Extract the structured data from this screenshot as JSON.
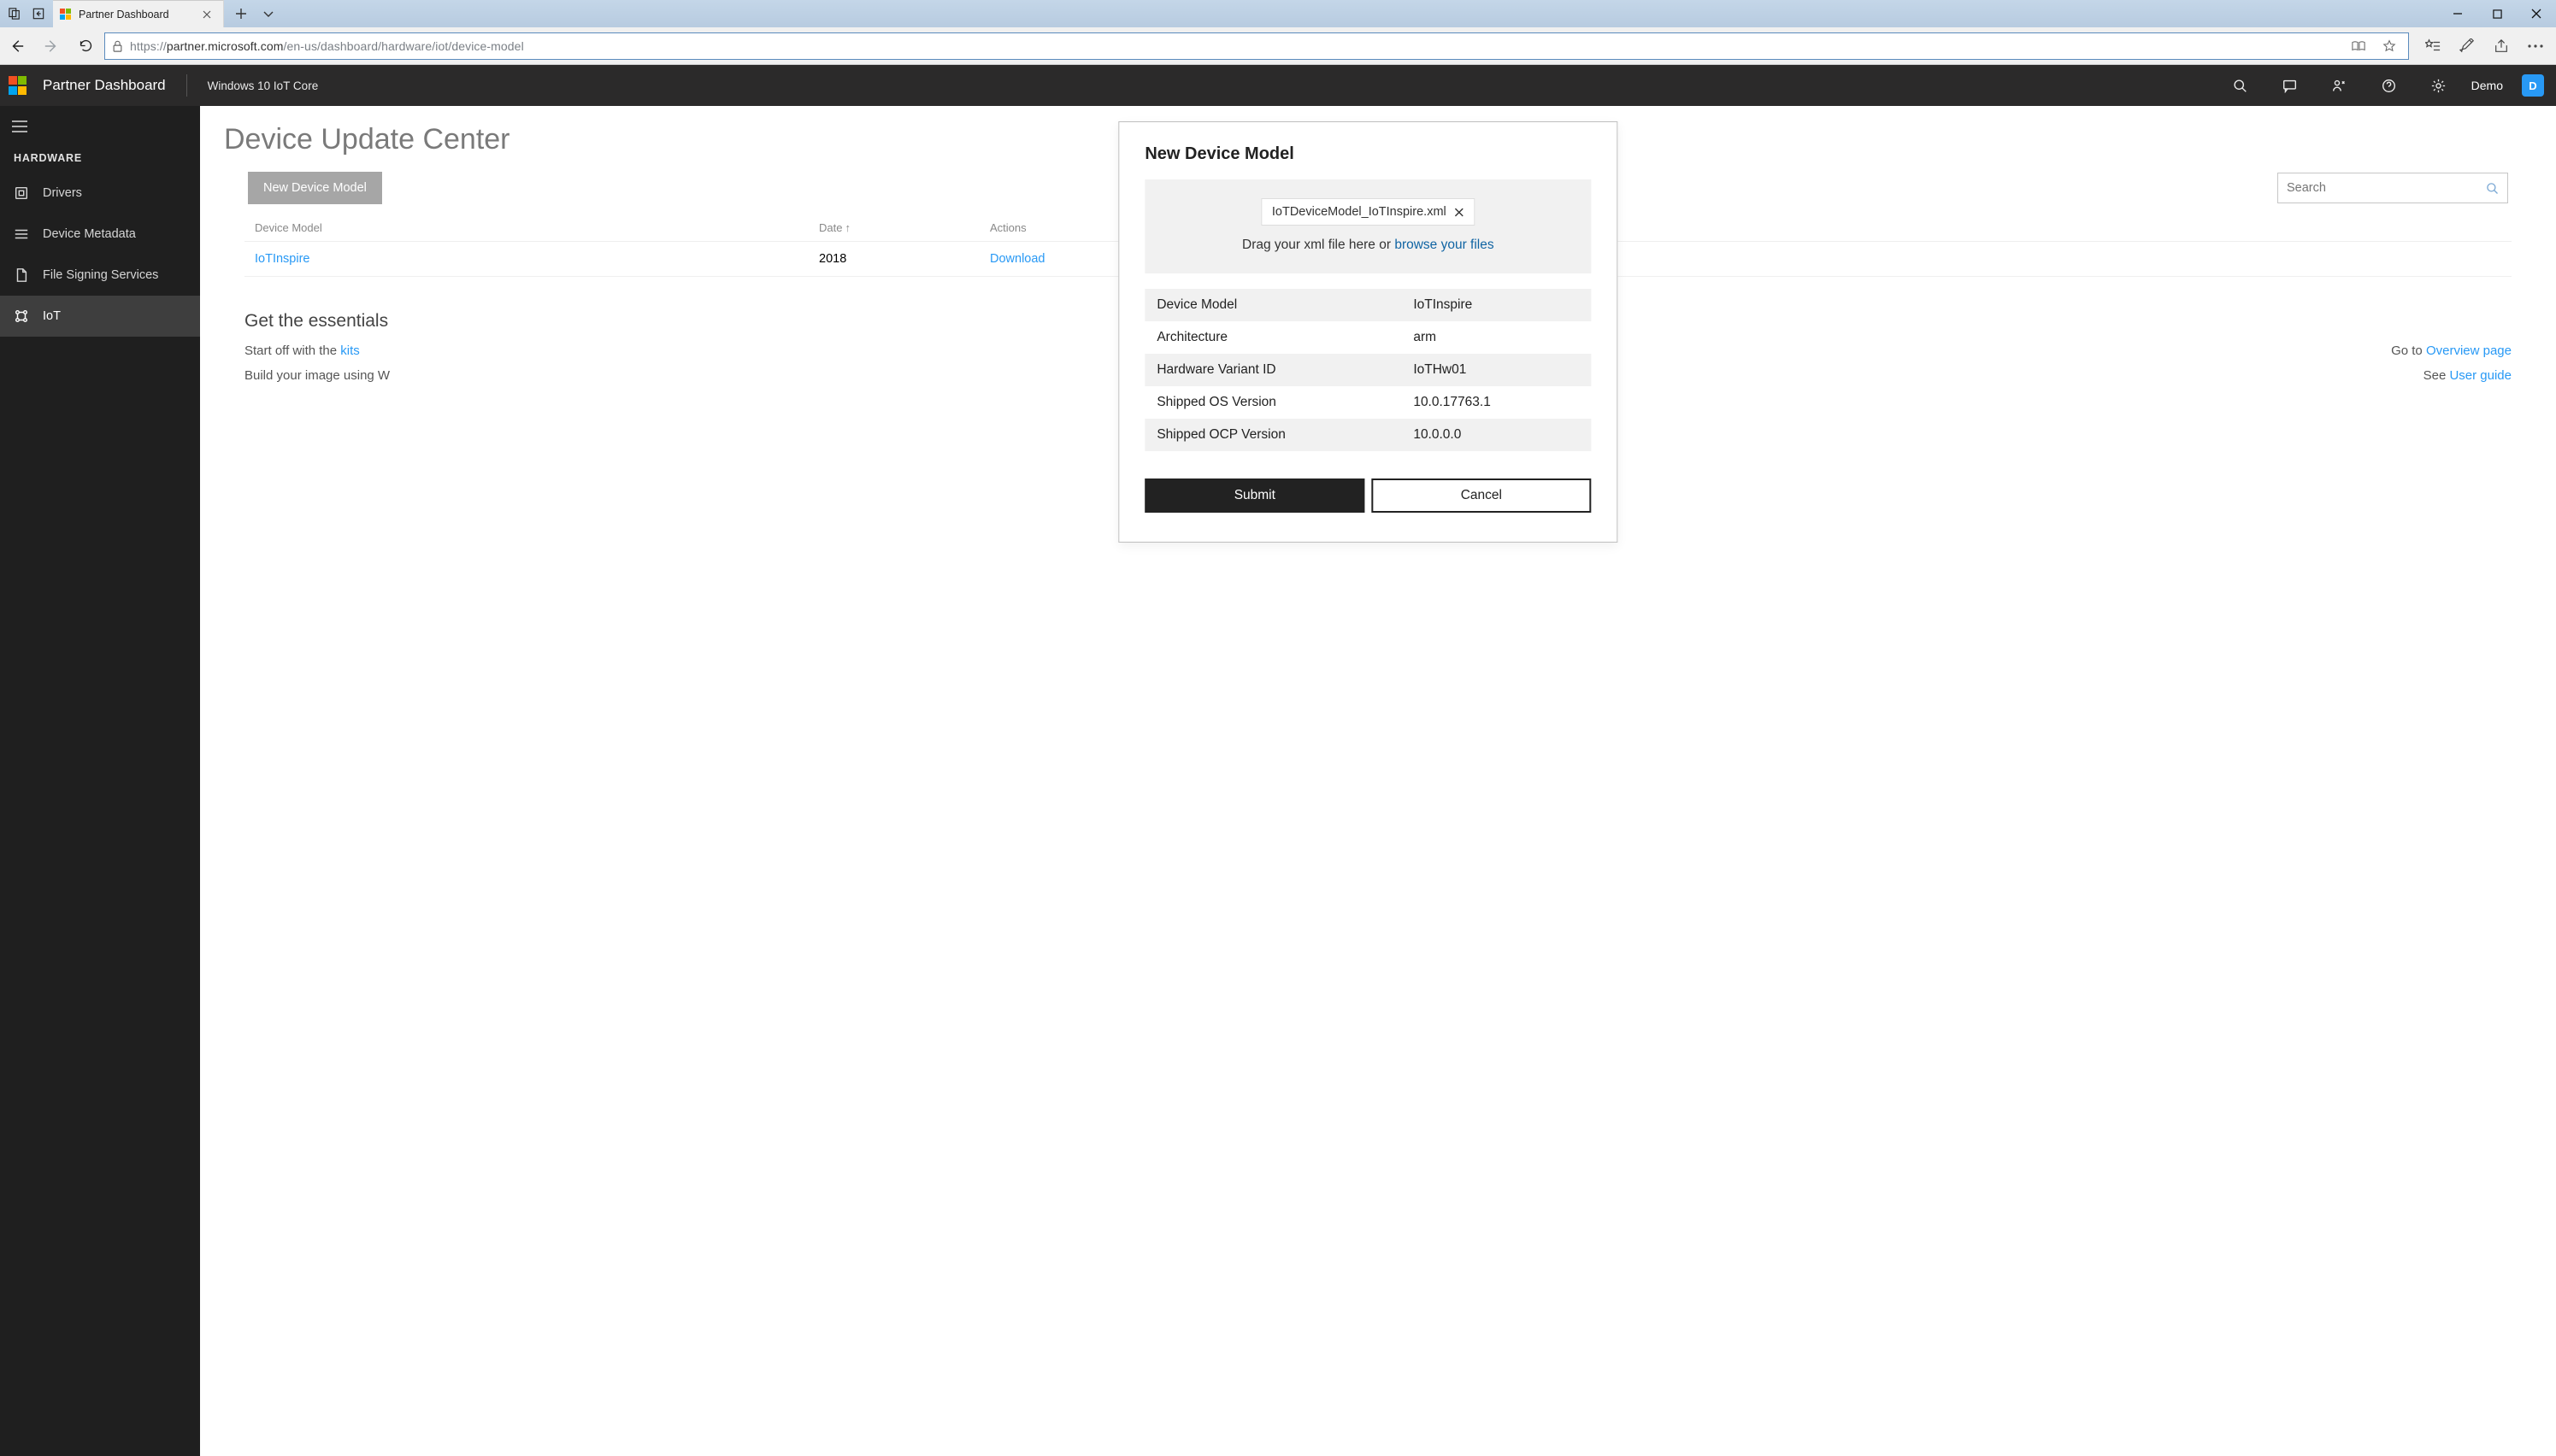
{
  "browser": {
    "tab_title": "Partner Dashboard",
    "url_prefix": "https://",
    "url_host": "partner.microsoft.com",
    "url_path": "/en-us/dashboard/hardware/iot/device-model"
  },
  "header": {
    "app_title": "Partner Dashboard",
    "app_subtitle": "Windows 10 IoT Core",
    "user_name": "Demo",
    "user_initial": "D"
  },
  "sidebar": {
    "section_label": "HARDWARE",
    "items": [
      {
        "label": "Drivers",
        "active": false
      },
      {
        "label": "Device Metadata",
        "active": false
      },
      {
        "label": "File Signing Services",
        "active": false
      },
      {
        "label": "IoT",
        "active": true
      }
    ]
  },
  "page": {
    "title": "Device Update Center",
    "new_button": "New Device Model",
    "search_placeholder": "Search",
    "table": {
      "col_model": "Device Model",
      "col_date": "Date",
      "col_actions": "Actions",
      "rows": [
        {
          "model": "IoTInspire",
          "date": "2018",
          "action": "Download"
        }
      ]
    },
    "essentials": {
      "title": "Get the essentials",
      "line1_prefix": "Start off with the ",
      "line1_link": "kits",
      "line2_prefix": "Build your image using W",
      "goto_prefix": "Go to ",
      "goto_link": "Overview page",
      "see_prefix": "See ",
      "see_link": "User guide"
    }
  },
  "modal": {
    "title": "New Device Model",
    "file_name": "IoTDeviceModel_IoTInspire.xml",
    "drop_hint_prefix": "Drag your xml file here or ",
    "drop_hint_link": "browse your files",
    "rows": [
      {
        "k": "Device Model",
        "v": "IoTInspire"
      },
      {
        "k": "Architecture",
        "v": "arm"
      },
      {
        "k": "Hardware Variant ID",
        "v": "IoTHw01"
      },
      {
        "k": "Shipped OS Version",
        "v": "10.0.17763.1"
      },
      {
        "k": "Shipped OCP Version",
        "v": "10.0.0.0"
      }
    ],
    "submit": "Submit",
    "cancel": "Cancel"
  }
}
